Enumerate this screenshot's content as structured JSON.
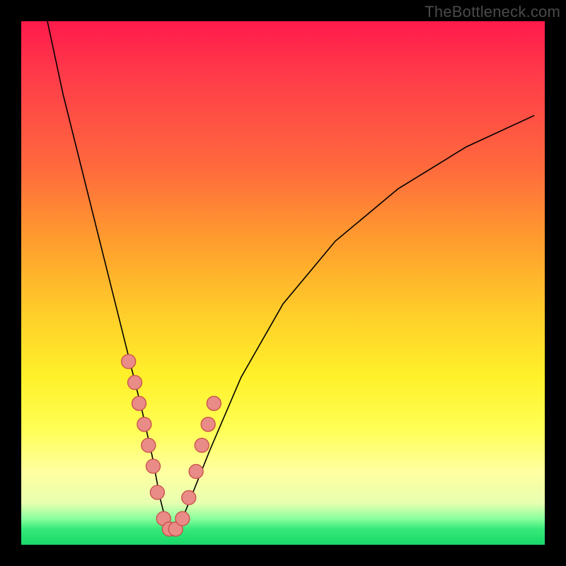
{
  "watermark": "TheBottleneck.com",
  "colors": {
    "frame": "#000000",
    "curve": "#000000",
    "dot_fill": "#e98b87",
    "dot_stroke": "#c94f4a",
    "gradient_top": "#ff1a4b",
    "gradient_bottom": "#18d86a"
  },
  "chart_data": {
    "type": "line",
    "title": "",
    "xlabel": "",
    "ylabel": "",
    "xlim": [
      0,
      100
    ],
    "ylim": [
      0,
      100
    ],
    "grid": false,
    "legend": false,
    "annotations": [
      "TheBottleneck.com"
    ],
    "series": [
      {
        "name": "curve",
        "x": [
          5,
          8,
          12,
          16,
          19,
          21,
          23,
          25,
          26.5,
          28,
          29,
          30,
          32,
          36,
          42,
          50,
          60,
          72,
          85,
          98
        ],
        "y": [
          100,
          86,
          70,
          54,
          42,
          34,
          26,
          17,
          9,
          3,
          2,
          3,
          8,
          18,
          32,
          46,
          58,
          68,
          76,
          82
        ]
      },
      {
        "name": "dots",
        "x": [
          20.5,
          21.7,
          22.5,
          23.5,
          24.3,
          25.2,
          26.0,
          27.2,
          28.3,
          29.5,
          30.8,
          32.0,
          33.4,
          34.5,
          35.7,
          36.8
        ],
        "y": [
          35,
          31,
          27,
          23,
          19,
          15,
          10,
          5,
          3,
          3,
          5,
          9,
          14,
          19,
          23,
          27
        ]
      }
    ]
  }
}
